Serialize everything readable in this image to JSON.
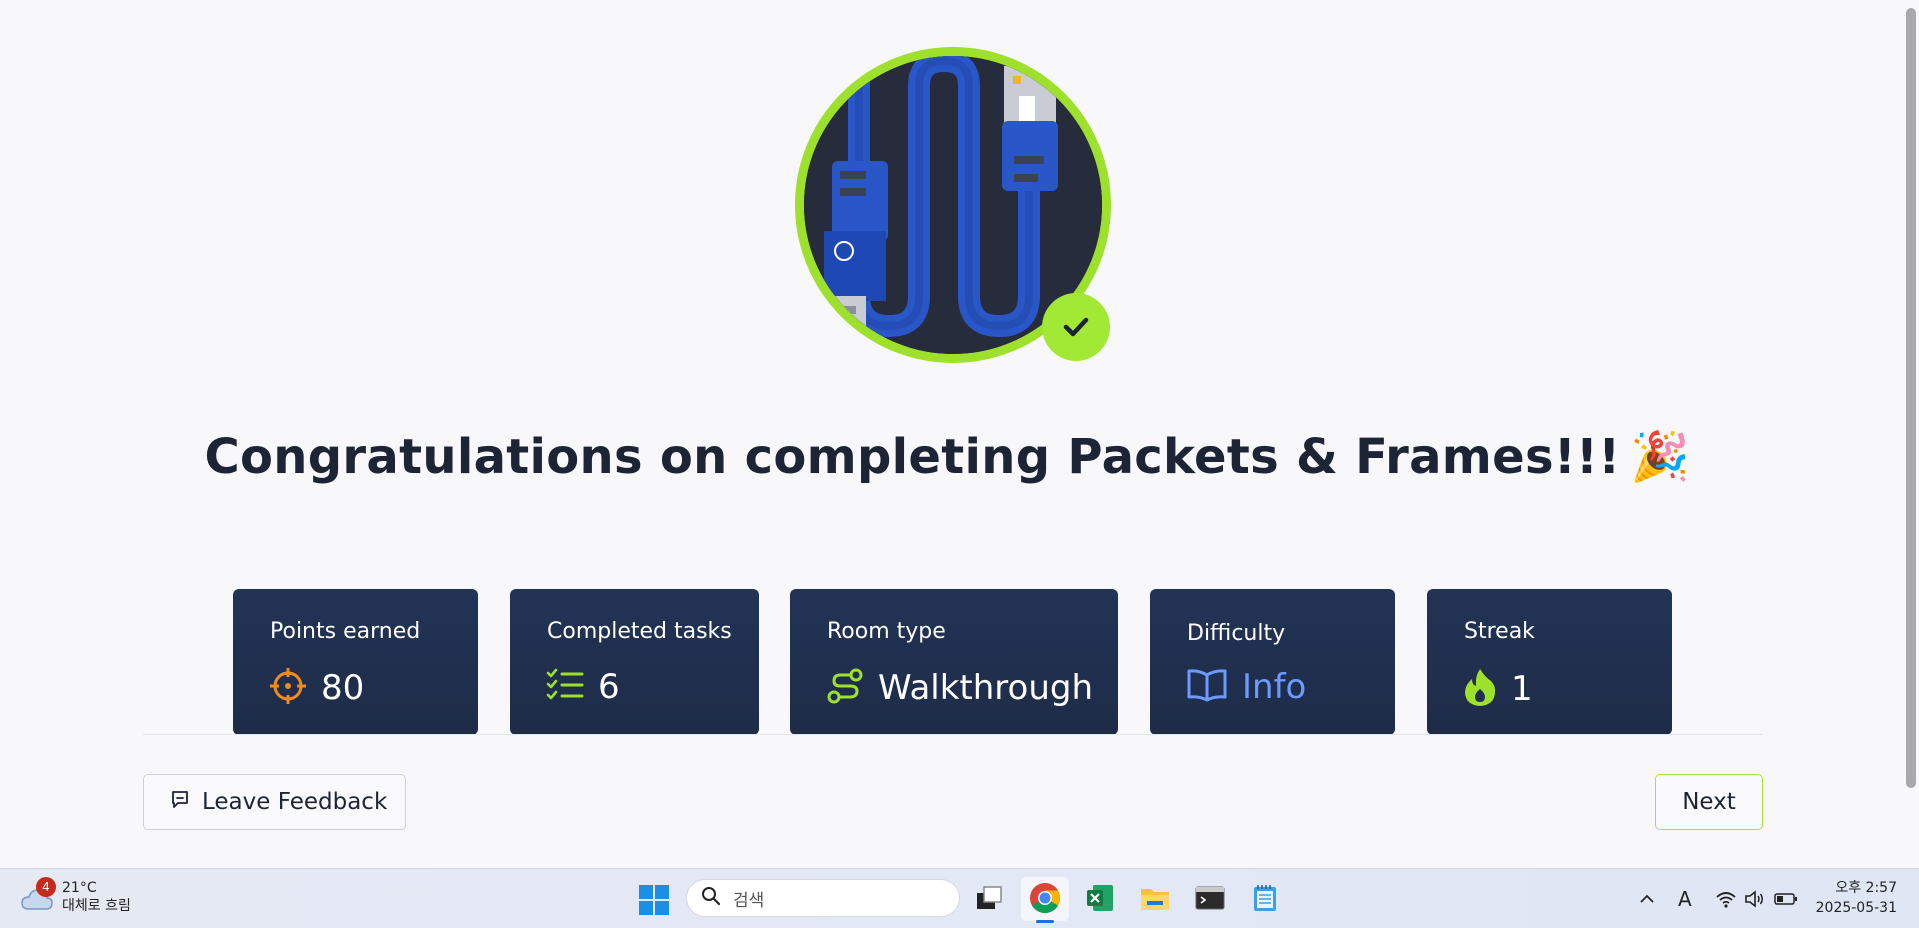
{
  "title": "Congratulations on completing Packets & Frames!!!",
  "title_emoji": "🎉",
  "stats": [
    {
      "label": "Points earned",
      "value": "80",
      "icon": "crosshair-icon"
    },
    {
      "label": "Completed tasks",
      "value": "6",
      "icon": "checklist-icon"
    },
    {
      "label": "Room type",
      "value": "Walkthrough",
      "icon": "route-icon"
    },
    {
      "label": "Difficulty",
      "value": "Info",
      "icon": "open-book-icon"
    },
    {
      "label": "Streak",
      "value": "1",
      "icon": "flame-icon"
    }
  ],
  "buttons": {
    "feedback": "Leave Feedback",
    "next": "Next"
  },
  "colors": {
    "accent_green": "#a3e635",
    "card_bg": "#213050",
    "icon_orange": "#f08c1e",
    "info_blue": "#6c9aff"
  },
  "taskbar": {
    "weather_badge": "4",
    "temperature": "21°C",
    "weather_desc": "대체로 흐림",
    "search_placeholder": "검색",
    "time": "오후 2:57",
    "date": "2025-05-31",
    "ime_indicator": "A"
  }
}
